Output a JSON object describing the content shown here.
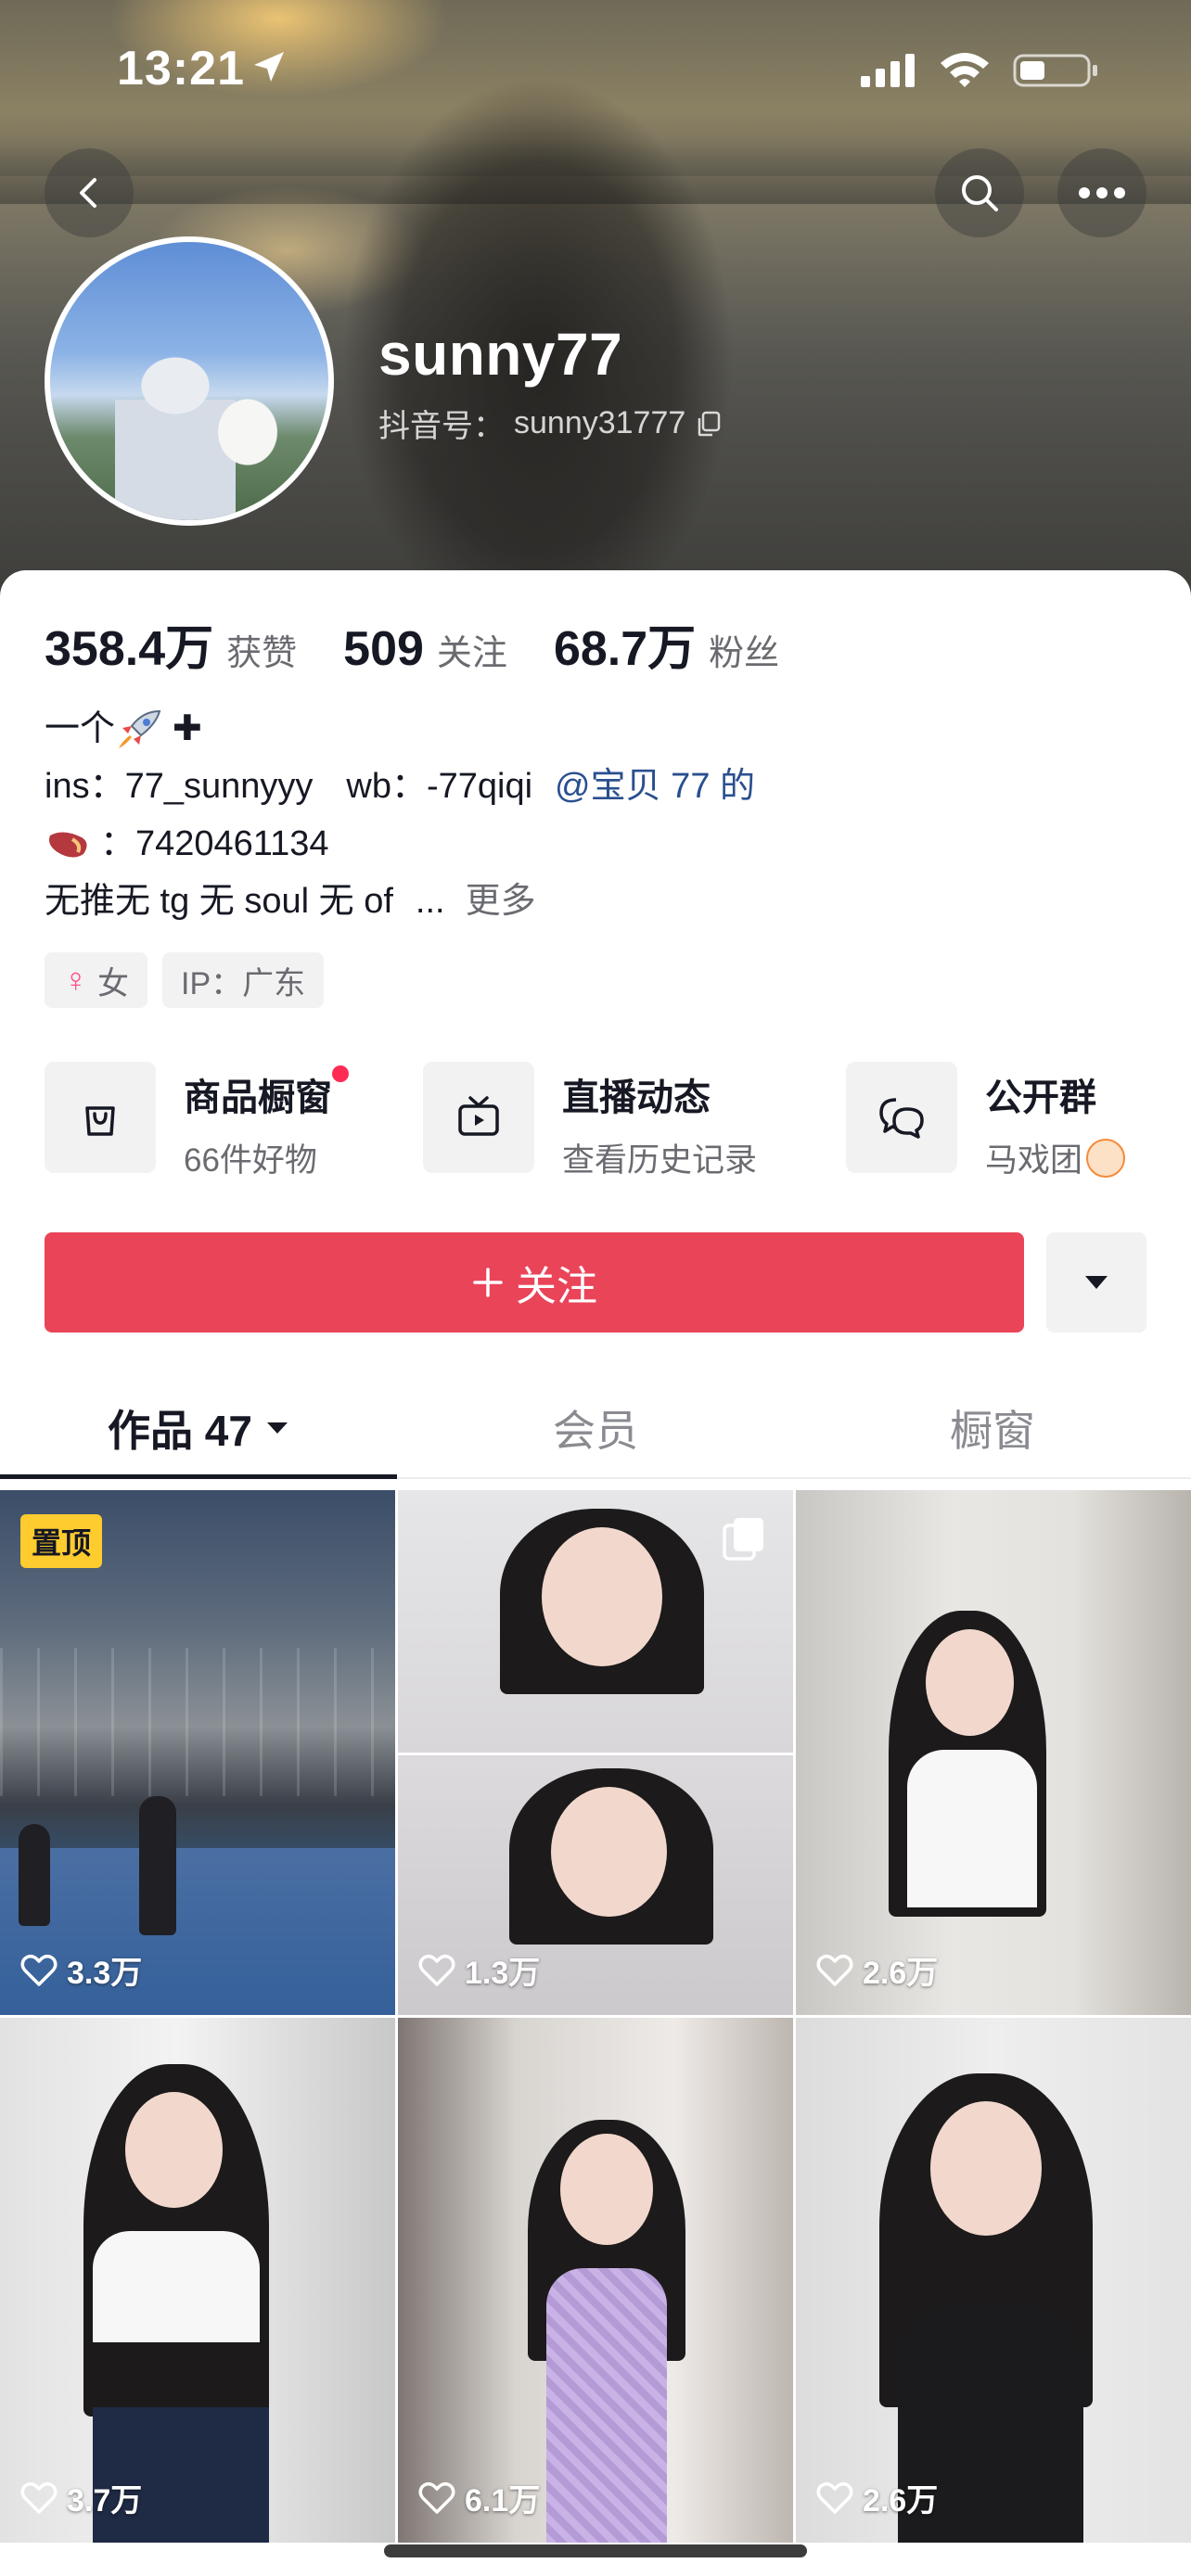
{
  "status_bar": {
    "time": "13:21"
  },
  "profile": {
    "username": "sunny77",
    "douyin_id_label": "抖音号：",
    "douyin_id": "sunny31777"
  },
  "stats": [
    {
      "value": "358.4万",
      "label": "获赞"
    },
    {
      "value": "509",
      "label": "关注"
    },
    {
      "value": "68.7万",
      "label": "粉丝"
    }
  ],
  "bio": {
    "line1_text": "一个",
    "line2_ins": "ins：77_sunnyyy",
    "line2_wb": "wb：-77qiqi",
    "line2_mention": "@宝贝 77 的",
    "line3_text": "：7420461134",
    "line4_text": "无推无 tg 无 soul 无 of",
    "line4_ellipsis": "...",
    "line4_more": "更多"
  },
  "tags": [
    {
      "label": "女"
    },
    {
      "label": "IP：广东"
    }
  ],
  "features": [
    {
      "title": "商品橱窗",
      "subtitle": "66件好物",
      "icon": "shopping-bag-icon"
    },
    {
      "title": "直播动态",
      "subtitle": "查看历史记录",
      "icon": "tv-icon"
    },
    {
      "title": "公开群",
      "subtitle": "马戏团",
      "icon": "chat-bubbles-icon"
    }
  ],
  "follow_button": {
    "label": "关注"
  },
  "tabs": [
    {
      "label": "作品 47",
      "active": true
    },
    {
      "label": "会员",
      "active": false
    },
    {
      "label": "橱窗",
      "active": false
    }
  ],
  "posts": [
    {
      "likes": "3.3万",
      "pinned_label": "置顶"
    },
    {
      "likes": "1.3万"
    },
    {
      "likes": "2.6万"
    },
    {
      "likes": "3.7万"
    },
    {
      "likes": "6.1万"
    },
    {
      "likes": "2.6万"
    }
  ],
  "colors": {
    "follow_red": "#ea4459",
    "mention_blue": "#2a4f8f",
    "pinned_yellow": "#fecc2e",
    "badge_red": "#fe2c55"
  }
}
